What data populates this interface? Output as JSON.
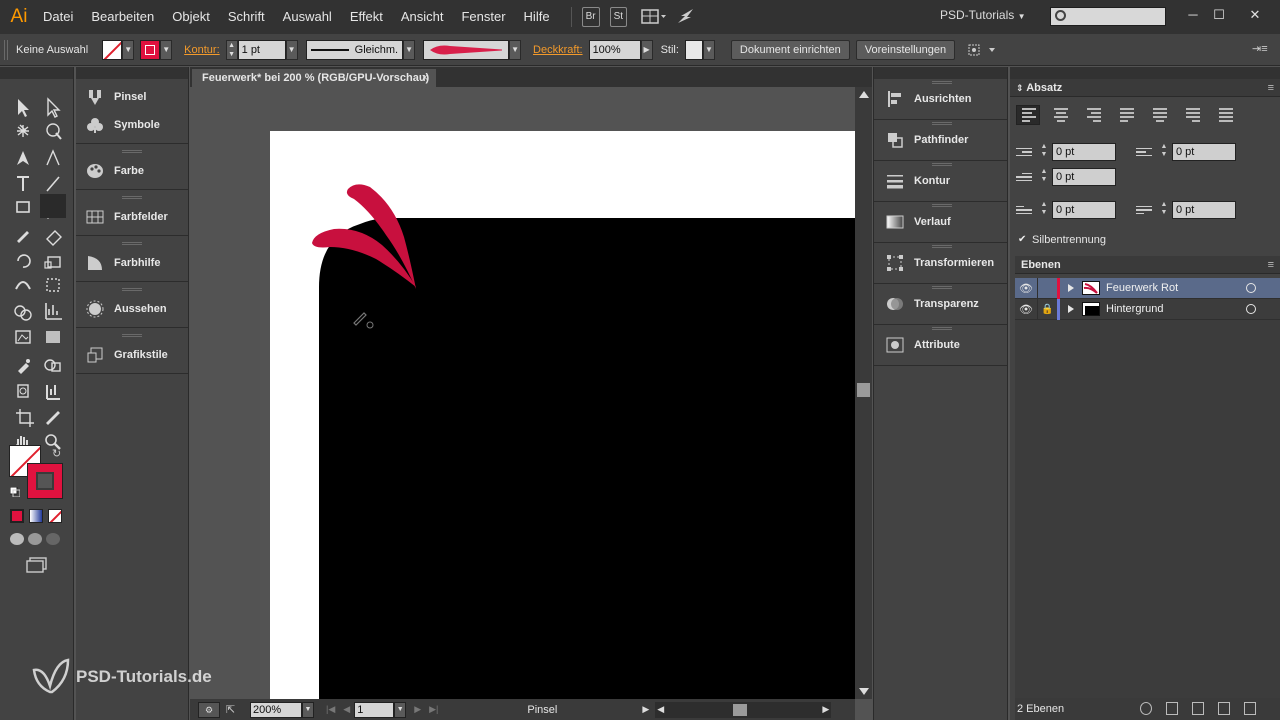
{
  "app": {
    "logo": "Ai",
    "accent": "#ff9a00"
  },
  "menu": {
    "items": [
      "Datei",
      "Bearbeiten",
      "Objekt",
      "Schrift",
      "Auswahl",
      "Effekt",
      "Ansicht",
      "Fenster",
      "Hilfe"
    ],
    "bridge": "Br",
    "stock": "St",
    "workspace": "PSD-Tutorials",
    "search_placeholder": ""
  },
  "control": {
    "selection": "Keine Auswahl",
    "stroke_label": "Kontur:",
    "stroke_weight": "1 pt",
    "stroke_profile": "Gleichm.",
    "opacity_label": "Deckkraft:",
    "opacity_value": "100%",
    "style_label": "Stil:",
    "document_setup": "Dokument einrichten",
    "preferences": "Voreinstellungen",
    "stroke_color": "#e0123f"
  },
  "document": {
    "tab_title": "Feuerwerk* bei 200 % (RGB/GPU-Vorschau)",
    "zoom": "200%",
    "artboard_nav": "1",
    "status_tool": "Pinsel"
  },
  "left_panels": {
    "groups": [
      [
        "Pinsel",
        "Symbole"
      ],
      [
        "Farbe"
      ],
      [
        "Farbfelder"
      ],
      [
        "Farbhilfe"
      ],
      [
        "Aussehen"
      ],
      [
        "Grafikstile"
      ]
    ]
  },
  "right_panels": [
    "Ausrichten",
    "Pathfinder",
    "Kontur",
    "Verlauf",
    "Transformieren",
    "Transparenz",
    "Attribute"
  ],
  "absatz": {
    "title": "Absatz",
    "indent_left": "0 pt",
    "indent_right": "0 pt",
    "first_line": "0 pt",
    "space_before": "0 pt",
    "space_after": "0 pt",
    "hyphenation": "Silbentrennung"
  },
  "layers": {
    "title": "Ebenen",
    "items": [
      {
        "name": "Feuerwerk Rot",
        "color": "#e0123f",
        "selected": true
      },
      {
        "name": "Hintergrund",
        "color": "#6a7ad8",
        "selected": false
      }
    ],
    "count": "2 Ebenen"
  },
  "watermark": "PSD-Tutorials.de"
}
